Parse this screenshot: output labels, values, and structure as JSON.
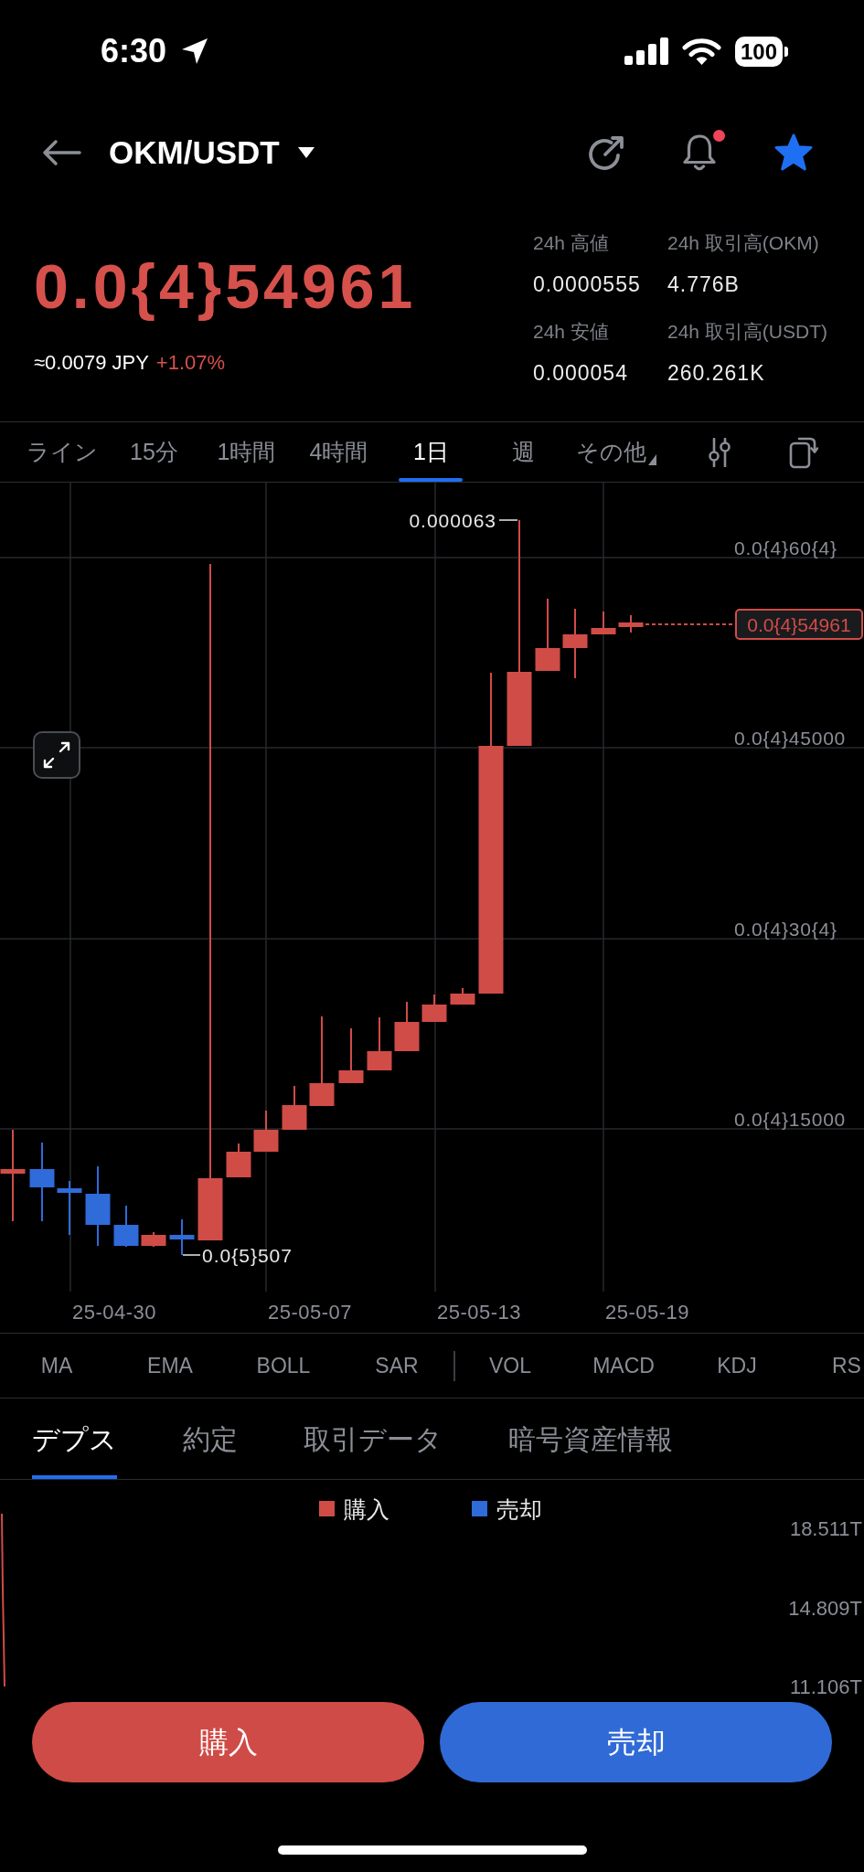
{
  "status_bar": {
    "time": "6:30",
    "battery": "100"
  },
  "header": {
    "pair": "OKM/USDT",
    "alert_unread": true,
    "favorited": true
  },
  "price": {
    "last": "0.0{4}54961",
    "fiat": "≈0.0079 JPY",
    "change": "+1.07%"
  },
  "stats": [
    {
      "label": "24h 高値",
      "value": "0.0000555"
    },
    {
      "label": "24h 取引高(OKM)",
      "value": "4.776B"
    },
    {
      "label": "24h 安値",
      "value": "0.000054"
    },
    {
      "label": "24h 取引高(USDT)",
      "value": "260.261K"
    }
  ],
  "timeframes": [
    {
      "label": "ライン",
      "selected": false,
      "kind": "option"
    },
    {
      "label": "15分",
      "selected": false,
      "kind": "option"
    },
    {
      "label": "1時間",
      "selected": false,
      "kind": "option"
    },
    {
      "label": "4時間",
      "selected": false,
      "kind": "option"
    },
    {
      "label": "1日",
      "selected": true,
      "kind": "option"
    },
    {
      "label": "週",
      "selected": false,
      "kind": "option"
    },
    {
      "label": "その他",
      "selected": false,
      "kind": "menu"
    }
  ],
  "chart": {
    "y_labels": [
      "0.0{4}60{4}",
      "0.0{4}45000",
      "0.0{4}30{4}",
      "0.0{4}15000"
    ],
    "x_labels": [
      "25-04-30",
      "25-05-07",
      "25-05-13",
      "25-05-19"
    ],
    "high_label": "0.000063",
    "low_label": "0.0{5}507",
    "last_price_tag": "0.0{4}54961"
  },
  "indicators": {
    "main": [
      "MA",
      "EMA",
      "BOLL",
      "SAR"
    ],
    "sub": [
      "VOL",
      "MACD",
      "KDJ",
      "RS"
    ]
  },
  "detail_tabs": [
    {
      "label": "デプス",
      "selected": true
    },
    {
      "label": "約定",
      "selected": false
    },
    {
      "label": "取引データ",
      "selected": false
    },
    {
      "label": "暗号資産情報",
      "selected": false
    }
  ],
  "depth": {
    "legend": [
      {
        "label": "購入",
        "color": "#d04c47"
      },
      {
        "label": "売却",
        "color": "#2f6bd9"
      }
    ],
    "y_labels": [
      "18.511T",
      "14.809T",
      "11.106T"
    ]
  },
  "actions": [
    {
      "label": "購入",
      "kind": "buy"
    },
    {
      "label": "売却",
      "kind": "sell"
    }
  ]
}
